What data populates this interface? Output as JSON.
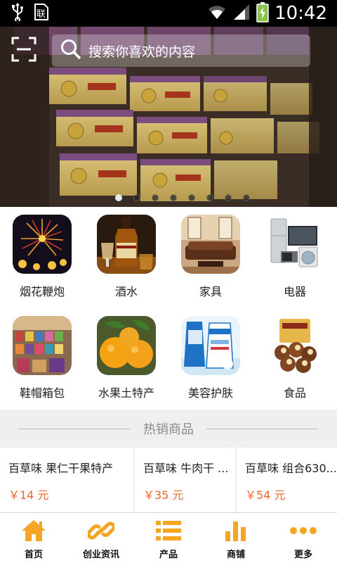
{
  "status_bar": {
    "time": "10:42",
    "icons": [
      "usb-icon",
      "sim-card-icon",
      "wifi-icon",
      "signal-icon",
      "battery-charging-icon"
    ]
  },
  "search": {
    "placeholder": "搜索你喜欢的内容",
    "scan_icon": "scan-icon",
    "search_icon": "search-icon"
  },
  "banner": {
    "slide_count": 8,
    "active_slide": 1
  },
  "categories": [
    {
      "label": "烟花鞭炮",
      "icon": "fireworks-image"
    },
    {
      "label": "酒水",
      "icon": "whisky-image"
    },
    {
      "label": "家具",
      "icon": "furniture-image"
    },
    {
      "label": "电器",
      "icon": "appliances-image"
    },
    {
      "label": "鞋帽箱包",
      "icon": "bags-shop-image"
    },
    {
      "label": "水果土特产",
      "icon": "oranges-image"
    },
    {
      "label": "美容护肤",
      "icon": "cleanser-image"
    },
    {
      "label": "食品",
      "icon": "nuts-image"
    }
  ],
  "hot_section": {
    "title": "热销商品"
  },
  "products": [
    {
      "name": "百草味 果仁干果特产",
      "price": "￥14 元"
    },
    {
      "name": "百草味 牛肉干 ...",
      "price": "￥35 元"
    },
    {
      "name": "百草味 组合630...",
      "price": "￥54 元"
    }
  ],
  "bottom_nav": [
    {
      "label": "首页",
      "icon": "home-icon"
    },
    {
      "label": "创业资讯",
      "icon": "link-icon"
    },
    {
      "label": "产品",
      "icon": "list-icon"
    },
    {
      "label": "商铺",
      "icon": "bar-chart-icon"
    },
    {
      "label": "更多",
      "icon": "more-dots-icon"
    }
  ],
  "colors": {
    "accent": "#f4a623",
    "price": "#f2642b",
    "section_bg": "#efeff1"
  }
}
